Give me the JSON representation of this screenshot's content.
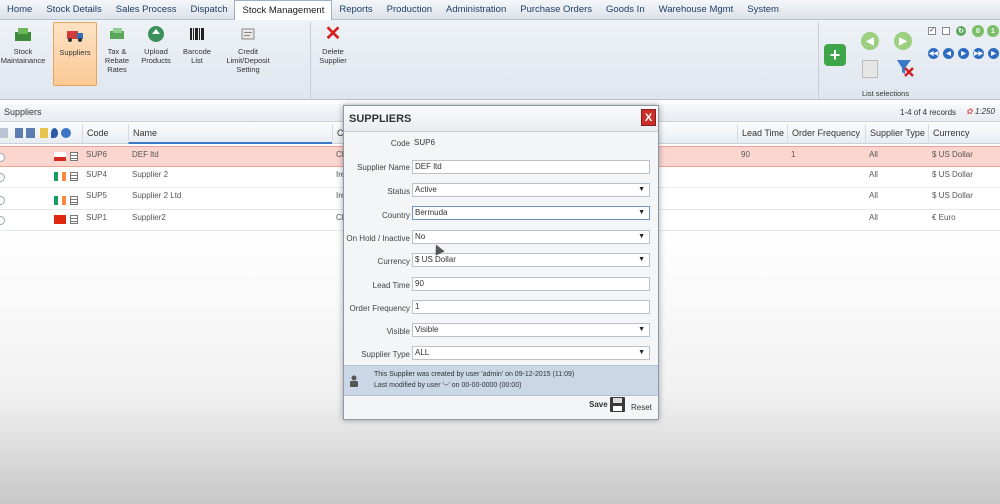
{
  "topnav": [
    "Home",
    "Stock Details",
    "Sales Process",
    "Dispatch",
    "Stock Management",
    "Reports",
    "Production",
    "Administration",
    "Purchase Orders",
    "Goods In",
    "Warehouse Mgmt",
    "System"
  ],
  "ribbon": {
    "buttons": [
      {
        "label": "Stock Maintainance",
        "icon": "stock-maintainance-icon"
      },
      {
        "label": "Suppliers",
        "icon": "suppliers-icon"
      },
      {
        "label": "Tax & Rebate Rates",
        "icon": "tax-rates-icon"
      },
      {
        "label": "Upload Products",
        "icon": "upload-products-icon"
      },
      {
        "label": "Barcode List",
        "icon": "barcode-icon"
      },
      {
        "label": "Credit Limit/Deposit Setting",
        "icon": "credit-limit-icon"
      },
      {
        "label": "Delete Supplier",
        "icon": "delete-icon"
      }
    ],
    "list_selections_label": "List selections"
  },
  "grid": {
    "title": "Suppliers",
    "records": "1-4 of 4 records",
    "page_size": "1:250",
    "columns": {
      "code": "Code",
      "name": "Name",
      "c": "C",
      "lead_time": "Lead Time",
      "order_frequency": "Order Frequency",
      "supplier_type": "Supplier Type",
      "currency": "Currency"
    },
    "rows": [
      {
        "code": "SUP6",
        "name": "DEF ltd",
        "c": "Ch",
        "lead_time": "90",
        "order_frequency": "1",
        "supplier_type": "All",
        "currency": "$ US Dollar"
      },
      {
        "code": "SUP4",
        "name": "Supplier 2",
        "c": "Ire",
        "lead_time": "",
        "order_frequency": "",
        "supplier_type": "All",
        "currency": "$ US Dollar"
      },
      {
        "code": "SUP5",
        "name": "Supplier 2 Ltd",
        "c": "Ire",
        "lead_time": "",
        "order_frequency": "",
        "supplier_type": "All",
        "currency": "$ US Dollar"
      },
      {
        "code": "SUP1",
        "name": "Supplier2",
        "c": "Ch",
        "lead_time": "",
        "order_frequency": "",
        "supplier_type": "All",
        "currency": "€ Euro"
      }
    ]
  },
  "modal": {
    "title": "SUPPLIERS",
    "close": "X",
    "fields": {
      "code": {
        "label": "Code",
        "value": "SUP6"
      },
      "supplier_name": {
        "label": "Supplier Name",
        "value": "DEF ltd"
      },
      "status": {
        "label": "Status",
        "value": "Active"
      },
      "country": {
        "label": "Country",
        "value": "Bermuda"
      },
      "on_hold": {
        "label": "On Hold / Inactive",
        "value": "No"
      },
      "currency": {
        "label": "Currency",
        "value": "$ US Dollar"
      },
      "lead_time": {
        "label": "Lead Time",
        "value": "90"
      },
      "order_frequency": {
        "label": "Order Frequency",
        "value": "1"
      },
      "visible": {
        "label": "Visible",
        "value": "Visible"
      },
      "supplier_type": {
        "label": "Supplier Type",
        "value": "ALL"
      }
    },
    "info_created": "This Supplier was created by user 'admin' on 09-12-2015 (11:09)",
    "info_modified": "Last modified by user '--' on 00-00-0000 (00:00)",
    "save": "Save",
    "reset": "Reset"
  },
  "colors": {
    "accent_orange": "#fbc995",
    "selected_row": "#fbd6cf",
    "close_red": "#c9302c",
    "info_blue": "#c9d7e7"
  }
}
